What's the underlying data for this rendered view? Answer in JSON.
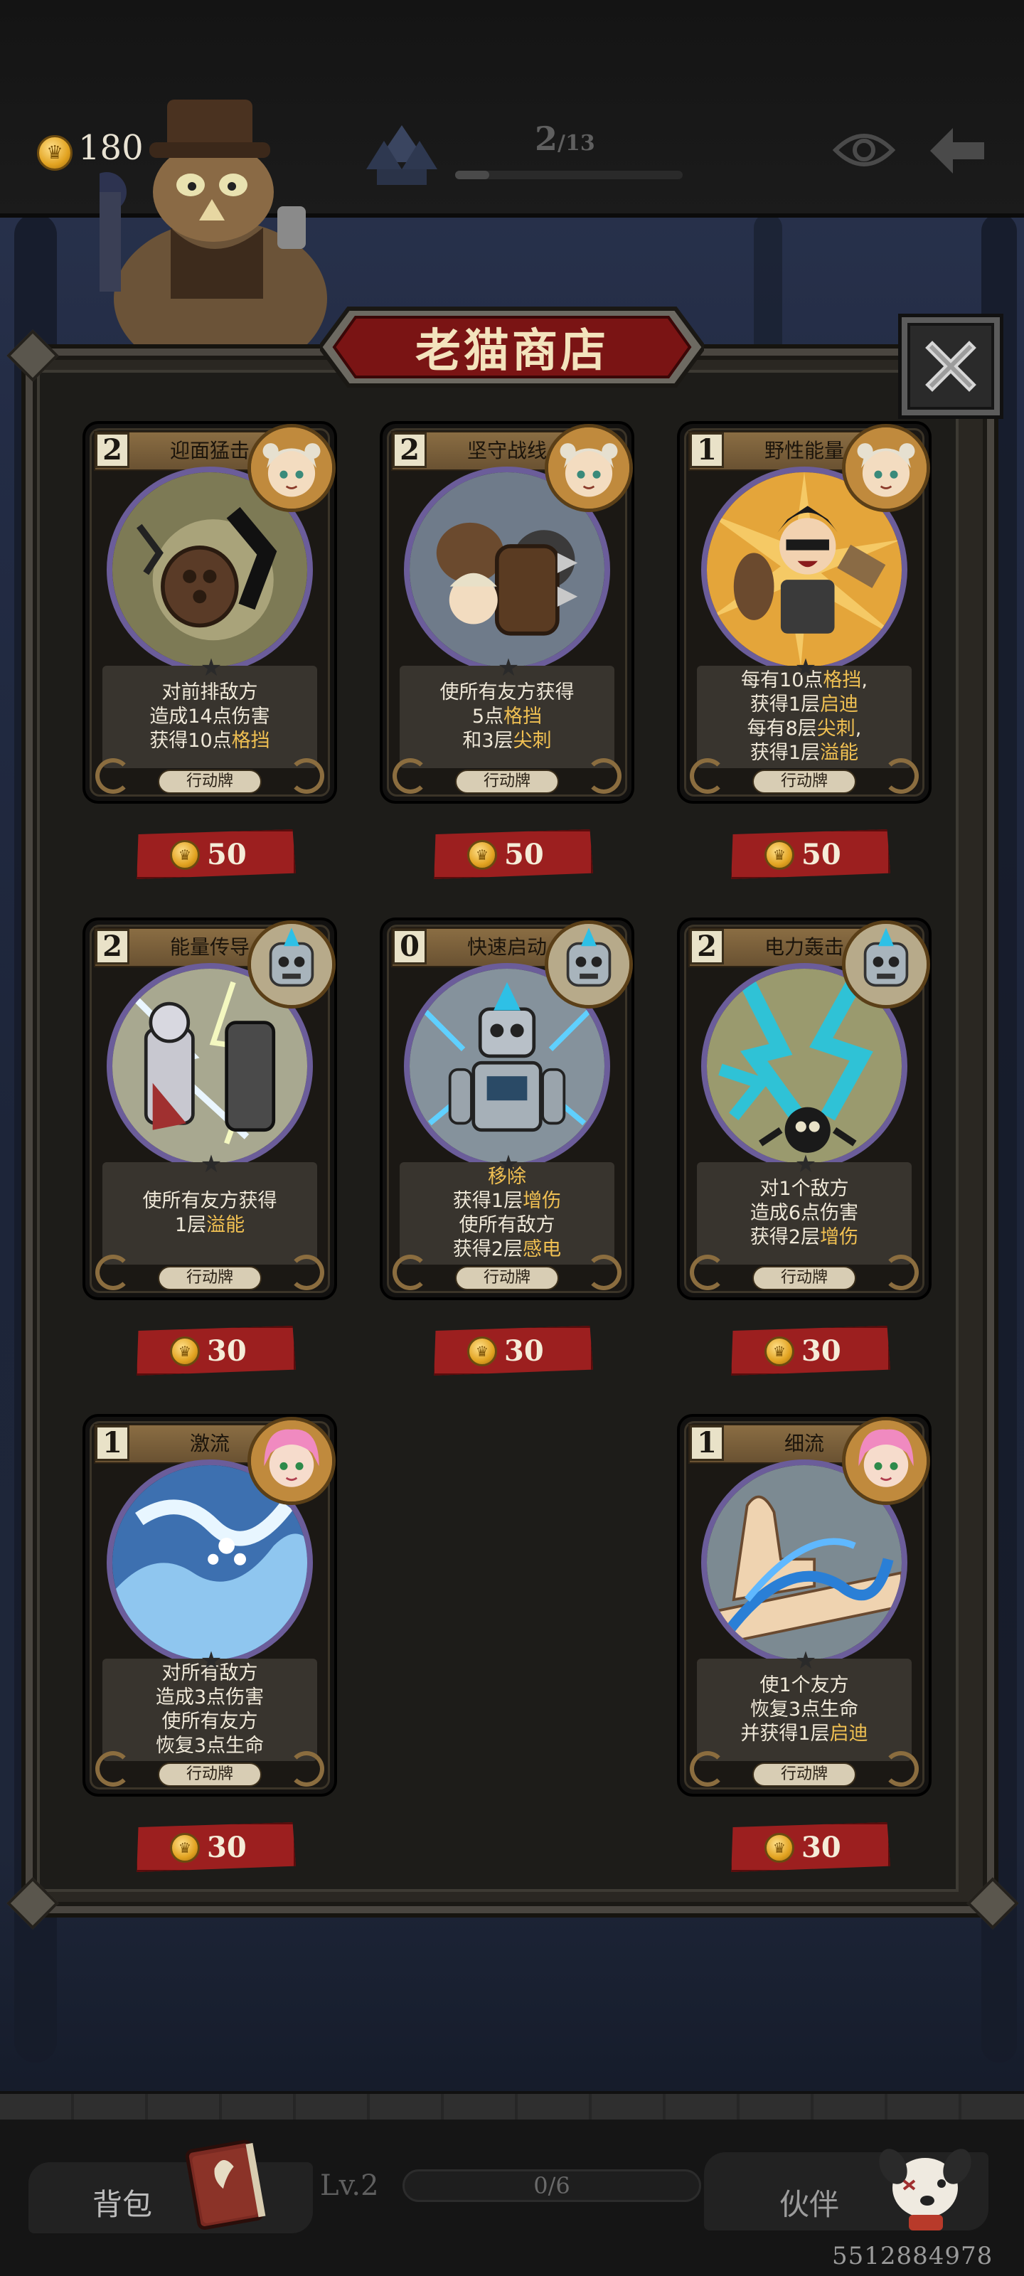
{
  "header": {
    "gold": "180",
    "stage_current": "2",
    "stage_total": "/13",
    "stage_progress": 0.15
  },
  "shop": {
    "title": "老猫商店"
  },
  "cards": [
    {
      "cost": "2",
      "name": "迎面猛击",
      "desc": [
        [
          "对前排敌方"
        ],
        [
          "造成14点伤害"
        ],
        [
          "获得10点",
          "格挡"
        ]
      ],
      "type": "行动牌",
      "price": "50",
      "art": "bandit",
      "portrait": "girl"
    },
    {
      "cost": "2",
      "name": "坚守战线",
      "desc": [
        [
          "使所有友方获得"
        ],
        [
          "5点",
          "格挡"
        ],
        [
          "和3层",
          "尖刺"
        ]
      ],
      "type": "行动牌",
      "price": "50",
      "art": "shield",
      "portrait": "girl"
    },
    {
      "cost": "1",
      "name": "野性能量",
      "desc": [
        [
          "每有10点",
          "格挡",
          ","
        ],
        [
          "获得1层",
          "启迪"
        ],
        [
          "每有8层",
          "尖刺",
          ","
        ],
        [
          "获得1层",
          "溢能"
        ]
      ],
      "type": "行动牌",
      "price": "50",
      "art": "wild",
      "portrait": "girl"
    },
    {
      "cost": "2",
      "name": "能量传导",
      "desc": [
        [
          "使所有友方获得"
        ],
        [
          "1层",
          "溢能"
        ]
      ],
      "type": "行动牌",
      "price": "30",
      "art": "lightning",
      "portrait": "robot"
    },
    {
      "cost": "0",
      "name": "快速启动",
      "desc": [
        [
          "",
          "移除"
        ],
        [
          "获得1层",
          "增伤"
        ],
        [
          "使所有敌方"
        ],
        [
          "获得2层",
          "感电"
        ]
      ],
      "type": "行动牌",
      "price": "30",
      "art": "robot",
      "portrait": "robot"
    },
    {
      "cost": "2",
      "name": "电力轰击",
      "desc": [
        [
          "对1个敌方"
        ],
        [
          "造成6点伤害"
        ],
        [
          "获得2层",
          "增伤"
        ]
      ],
      "type": "行动牌",
      "price": "30",
      "art": "bolt",
      "portrait": "robot"
    },
    {
      "cost": "1",
      "name": "激流",
      "desc": [
        [
          "对所有敌方"
        ],
        [
          "造成3点伤害"
        ],
        [
          "使所有友方"
        ],
        [
          "恢复3点生命"
        ]
      ],
      "type": "行动牌",
      "price": "30",
      "art": "wave",
      "portrait": "pink"
    },
    {
      "cost": "1",
      "name": "细流",
      "desc": [
        [
          "使1个友方"
        ],
        [
          "恢复3点生命"
        ],
        [
          "并获得1层",
          "启迪"
        ]
      ],
      "type": "行动牌",
      "price": "30",
      "art": "stream",
      "portrait": "pink"
    }
  ],
  "bottom": {
    "bag_label": "背包",
    "level": "Lv.2",
    "xp": "0/6",
    "xp_fraction": 0,
    "partner_label": "伙伴",
    "user_id": "5512884978"
  },
  "colors": {
    "keyword": "#f0c052",
    "price_tag": "#9c1f1f",
    "panel": "#1d1c19"
  }
}
